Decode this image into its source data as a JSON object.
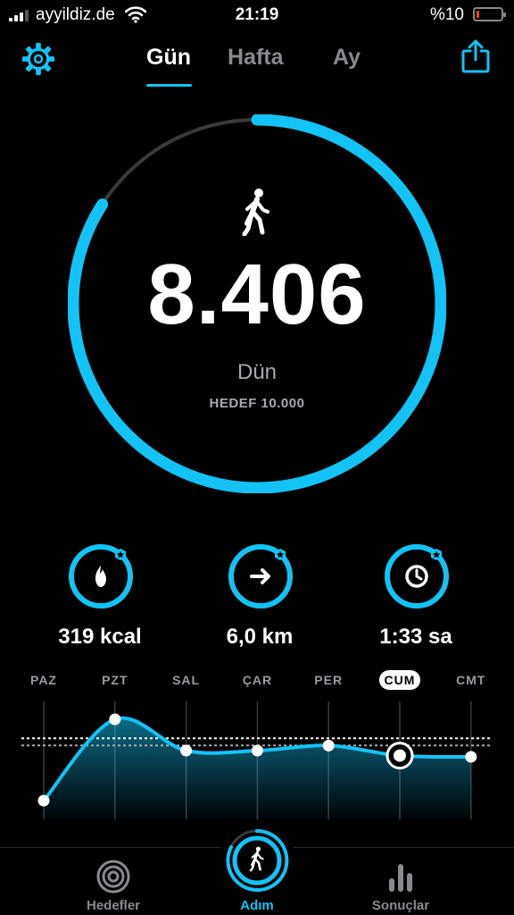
{
  "status_bar": {
    "carrier": "ayyildiz.de",
    "time": "21:19",
    "battery_percent": "%10",
    "battery_level": 0.1
  },
  "nav": {
    "tabs": [
      {
        "label": "Gün",
        "active": true
      },
      {
        "label": "Hafta",
        "active": false
      },
      {
        "label": "Ay",
        "active": false
      }
    ],
    "settings_icon": "gear-icon",
    "share_icon": "share-icon"
  },
  "summary": {
    "steps": "8.406",
    "day": "Dün",
    "goal": "HEDEF 10.000",
    "progress": 0.8406,
    "icon": "walking-icon"
  },
  "stats": [
    {
      "value": "319 kcal",
      "icon": "flame-icon"
    },
    {
      "value": "6,0 km",
      "icon": "arrow-right-icon"
    },
    {
      "value": "1:33 sa",
      "icon": "clock-icon"
    }
  ],
  "week_chart": {
    "days": [
      "PAZ",
      "PZT",
      "SAL",
      "ÇAR",
      "PER",
      "CUM",
      "CMT"
    ],
    "selected_day": "CUM",
    "relative_values": [
      0.15,
      0.8,
      0.55,
      0.55,
      0.59,
      0.51,
      0.5
    ],
    "goal_level": 0.62
  },
  "tab_bar": {
    "items": [
      {
        "label": "Hedefler",
        "icon": "target-icon",
        "active": false
      },
      {
        "label": "Adım",
        "icon": "walking-icon",
        "active": true
      },
      {
        "label": "Sonuçlar",
        "icon": "bar-chart-icon",
        "active": false
      }
    ]
  },
  "colors": {
    "accent": "#13c3f5",
    "ring_track": "#3a3a3c",
    "muted_text": "#8a8a8e",
    "background": "#000000"
  }
}
